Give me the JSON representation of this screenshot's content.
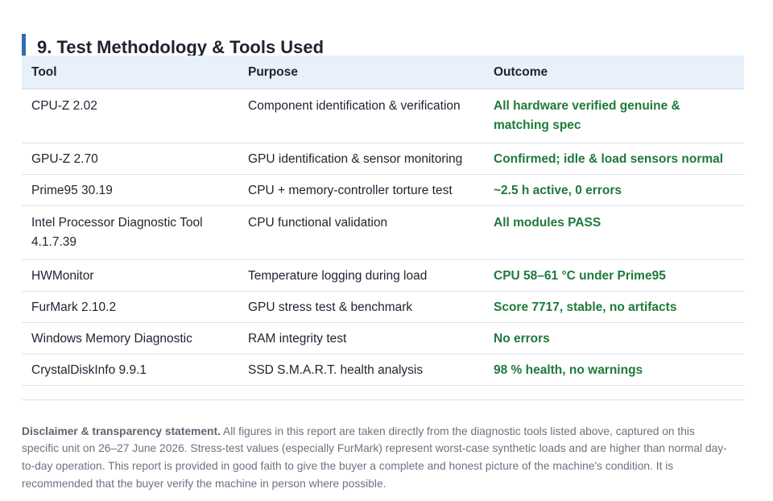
{
  "section": {
    "title": "9. Test Methodology & Tools Used"
  },
  "table": {
    "headers": {
      "tool": "Tool",
      "purpose": "Purpose",
      "outcome": "Outcome"
    },
    "rows": [
      {
        "tool": "CPU-Z 2.02",
        "purpose": "Component identification & verification",
        "outcome": "All hardware verified genuine & matching spec"
      },
      {
        "tool": "GPU-Z 2.70",
        "purpose": "GPU identification & sensor monitoring",
        "outcome": "Confirmed; idle & load sensors normal"
      },
      {
        "tool": "Prime95 30.19",
        "purpose": "CPU + memory-controller torture test",
        "outcome": "~2.5 h active, 0 errors"
      },
      {
        "tool": "Intel Processor Diagnostic Tool 4.1.7.39",
        "purpose": "CPU functional validation",
        "outcome": "All modules PASS"
      },
      {
        "tool": "HWMonitor",
        "purpose": "Temperature logging during load",
        "outcome": "CPU 58–61 °C under Prime95"
      },
      {
        "tool": "FurMark 2.10.2",
        "purpose": "GPU stress test & benchmark",
        "outcome": "Score 7717, stable, no artifacts"
      },
      {
        "tool": "Windows Memory Diagnostic",
        "purpose": "RAM integrity test",
        "outcome": "No errors"
      },
      {
        "tool": "CrystalDiskInfo 9.9.1",
        "purpose": "SSD S.M.A.R.T. health analysis",
        "outcome": "98 % health, no warnings"
      }
    ]
  },
  "disclaimer": {
    "lead": "Disclaimer & transparency statement.",
    "body": " All figures in this report are taken directly from the diagnostic tools listed above, captured on this specific unit on 26–27 June 2026. Stress-test values (especially FurMark) represent worst-case synthetic loads and are higher than normal day-to-day operation. This report is provided in good faith to give the buyer a complete and honest picture of the machine's condition. It is recommended that the buyer verify the machine in person where possible."
  },
  "colors": {
    "accent_bar": "#2f6db0",
    "header_bg": "#e8f0f9",
    "outcome_green": "#1f7a3a",
    "disclaimer_text": "#6b7280"
  }
}
